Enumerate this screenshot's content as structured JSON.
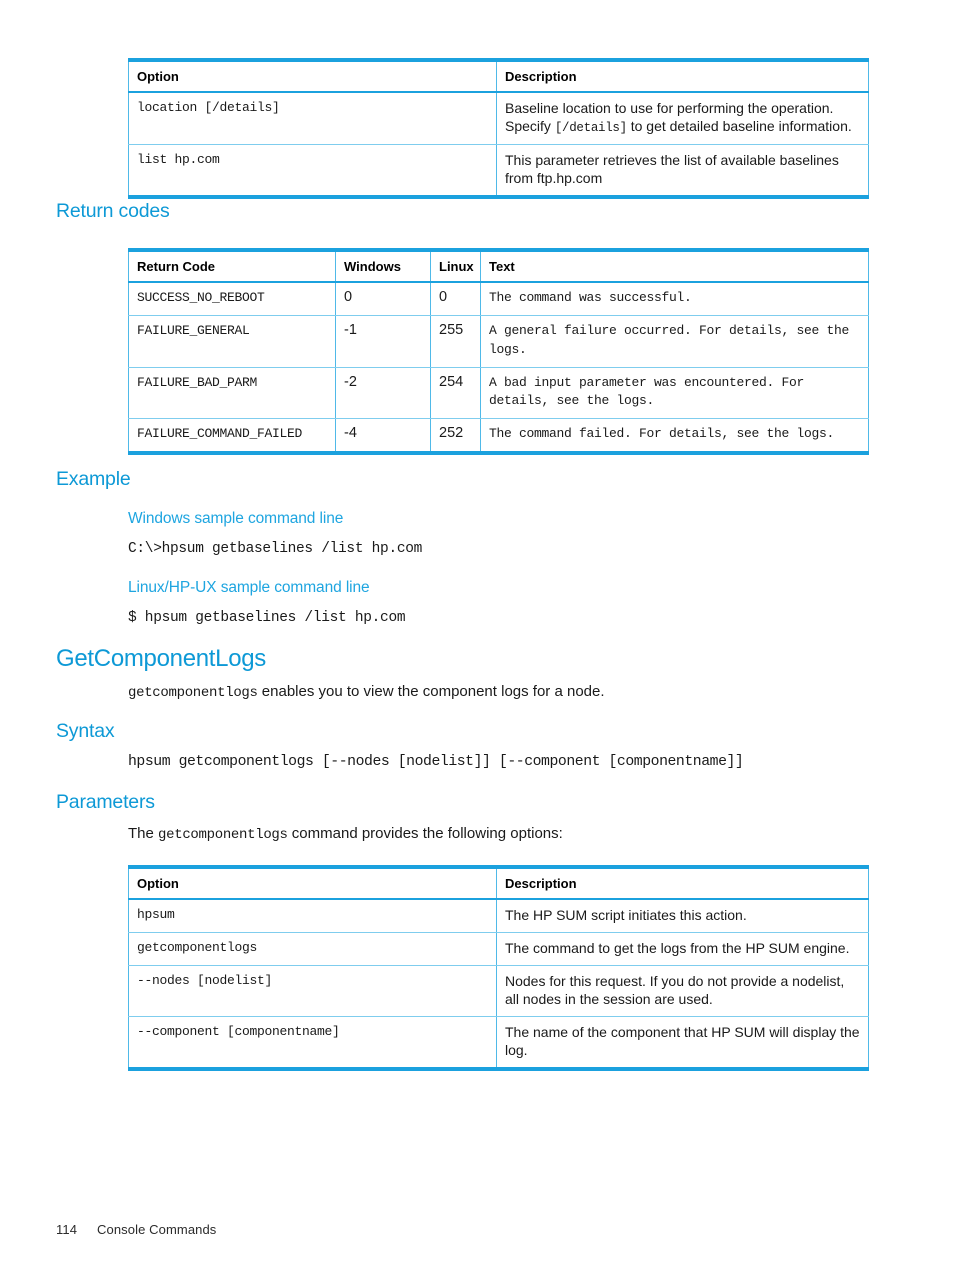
{
  "page": {
    "footer_page_number": "114",
    "footer_chapter": "Console Commands"
  },
  "colors": {
    "heading_blue": "#0d99d6",
    "subheading_blue": "#1ea5e0",
    "table_border_thick": "#1ba1de",
    "table_border_thin": "#7fcdee",
    "body_text": "#1a1a1a"
  },
  "getbaselines_options_table": {
    "headers": [
      "Option",
      "Description"
    ],
    "rows": [
      {
        "option": "location [/details]",
        "description_pre": "Baseline location to use for performing the operation. Specify ",
        "description_mono": "[/details]",
        "description_post": " to get detailed baseline information."
      },
      {
        "option": "list hp.com",
        "description_pre": "This parameter retrieves the list of available baselines from ftp.hp.com",
        "description_mono": "",
        "description_post": ""
      }
    ]
  },
  "return_codes": {
    "heading": "Return codes",
    "headers": [
      "Return Code",
      "Windows",
      "Linux",
      "Text"
    ],
    "rows": [
      {
        "code": "SUCCESS_NO_REBOOT",
        "windows": "0",
        "linux": "0",
        "text": "The command was successful."
      },
      {
        "code": "FAILURE_GENERAL",
        "windows": "-1",
        "linux": "255",
        "text": "A general failure occurred. For details, see the logs."
      },
      {
        "code": "FAILURE_BAD_PARM",
        "windows": "-2",
        "linux": "254",
        "text": "A bad input parameter was encountered. For details, see the logs."
      },
      {
        "code": "FAILURE_COMMAND_FAILED",
        "windows": "-4",
        "linux": "252",
        "text": "The command failed. For details, see the logs."
      }
    ]
  },
  "example": {
    "heading": "Example",
    "windows_subheading": "Windows sample command line",
    "windows_command": "C:\\>hpsum getbaselines /list hp.com",
    "linux_subheading": "Linux/HP-UX sample command line",
    "linux_command": "$ hpsum getbaselines /list hp.com"
  },
  "getcomponentlogs": {
    "heading": "GetComponentLogs",
    "intro_mono": "getcomponentlogs",
    "intro_text": " enables you to view the component logs for a node.",
    "syntax_heading": "Syntax",
    "syntax_line": "hpsum getcomponentlogs [--nodes [nodelist]] [--component [componentname]]",
    "parameters_heading": "Parameters",
    "parameters_intro_pre": "The ",
    "parameters_intro_mono": "getcomponentlogs",
    "parameters_intro_post": " command provides the following options:",
    "options_table": {
      "headers": [
        "Option",
        "Description"
      ],
      "rows": [
        {
          "option": "hpsum",
          "description": "The HP SUM script initiates this action."
        },
        {
          "option": "getcomponentlogs",
          "description": "The command to get the logs from the HP SUM engine."
        },
        {
          "option": "--nodes [nodelist]",
          "description": "Nodes for this request. If you do not provide a nodelist, all nodes in the session are used."
        },
        {
          "option": "--component [componentname]",
          "description": "The name of the component that HP SUM will display the log."
        }
      ]
    }
  }
}
